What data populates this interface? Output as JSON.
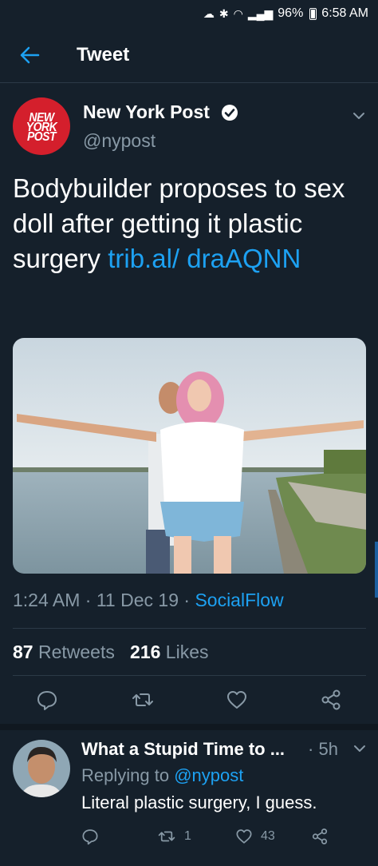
{
  "status_bar": {
    "battery": "96%",
    "time": "6:58 AM"
  },
  "header": {
    "title": "Tweet"
  },
  "tweet": {
    "author_name": "New York Post",
    "author_handle": "@nypost",
    "avatar_text": [
      "NEW",
      "YORK",
      "POST"
    ],
    "text": "Bodybuilder proposes to sex doll after getting it plastic surgery ",
    "link": "trib.al/ draAQNN",
    "time": "1:24 AM",
    "date": "11 Dec 19",
    "source": "SocialFlow",
    "retweets_count": "87",
    "retweets_label": "Retweets",
    "likes_count": "216",
    "likes_label": "Likes"
  },
  "reply": {
    "author_name": "What a Stupid Time to ...",
    "time": "5h",
    "replying_to_label": "Replying to",
    "replying_to_handle": "@nypost",
    "text": "Literal plastic surgery, I guess.",
    "retweets": "1",
    "likes": "43"
  },
  "colors": {
    "background": "#15202b",
    "link": "#1da1f2",
    "secondary": "#8899a6",
    "nyp_red": "#d41f2c"
  }
}
